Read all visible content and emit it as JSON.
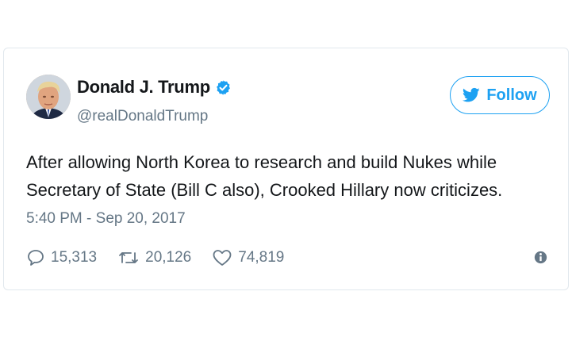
{
  "tweet": {
    "author": {
      "display_name": "Donald J. Trump",
      "handle": "@realDonaldTrump",
      "verified": true
    },
    "follow_button": {
      "label": "Follow",
      "icon": "twitter-bird-icon"
    },
    "text_lines": [
      "After allowing North Korea to research and build Nukes while",
      "Secretary of State (Bill C also), Crooked Hillary now criticizes."
    ],
    "timestamp": "5:40 PM - Sep 20, 2017",
    "actions": {
      "replies": {
        "count": "15,313",
        "icon": "reply-icon"
      },
      "retweets": {
        "count": "20,126",
        "icon": "retweet-icon"
      },
      "likes": {
        "count": "74,819",
        "icon": "heart-icon"
      }
    },
    "info_icon": "info-icon"
  },
  "colors": {
    "brand_blue": "#1da1f2",
    "text_primary": "#14171a",
    "text_secondary": "#657786",
    "border": "#e1e8ed"
  }
}
